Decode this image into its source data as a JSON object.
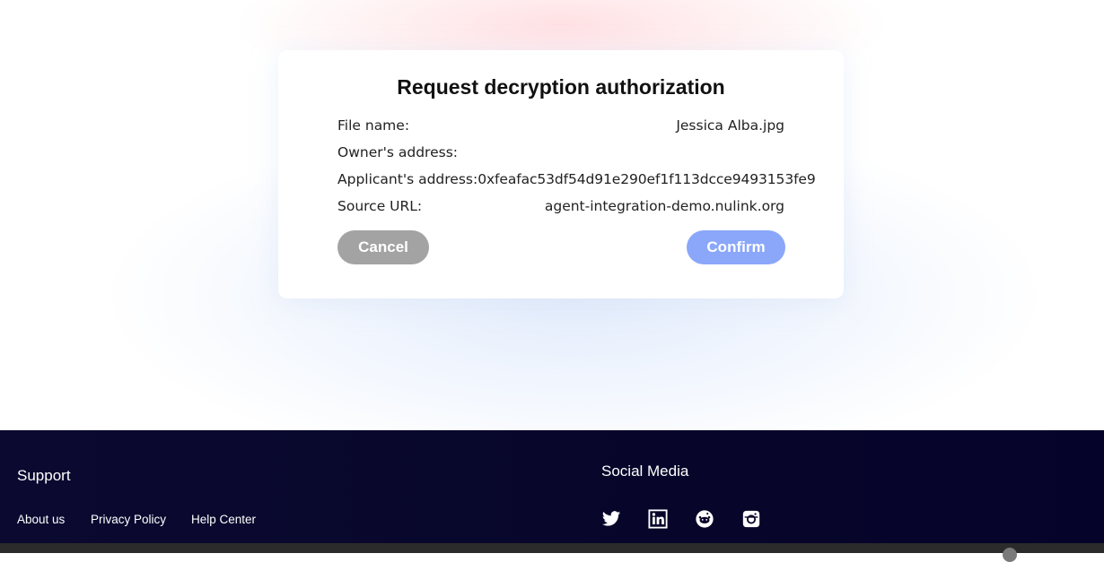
{
  "dialog": {
    "title": "Request decryption authorization",
    "rows": [
      {
        "label": "File name:",
        "value": "Jessica Alba.jpg"
      },
      {
        "label": "Owner's address:",
        "value": ""
      },
      {
        "label": "Applicant's address:",
        "value": "0xfeafac53df54d91e290ef1f113dcce9493153fe9"
      },
      {
        "label": "Source URL:",
        "value": "agent-integration-demo.nulink.org"
      }
    ],
    "cancel_label": "Cancel",
    "confirm_label": "Confirm"
  },
  "footer": {
    "support_heading": "Support",
    "links": [
      "About us",
      "Privacy Policy",
      "Help Center"
    ],
    "social_heading": "Social Media",
    "social_icons": [
      "twitter-icon",
      "linkedin-icon",
      "reddit-icon",
      "instagram-icon"
    ]
  },
  "colors": {
    "cancel": "#a3a3a3",
    "confirm": "#8aa7fa",
    "footer_bg": "#07062a"
  }
}
